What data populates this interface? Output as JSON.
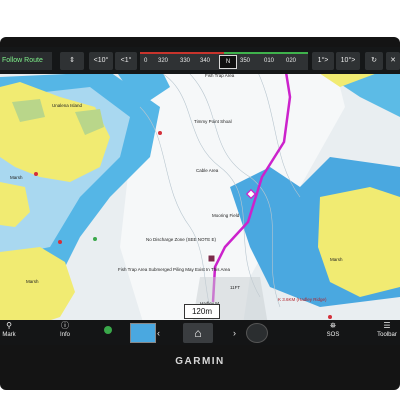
{
  "app": {
    "brand": "GARMIN"
  },
  "topbar": {
    "route_label": "Follow Route",
    "route_icon": "route-icon",
    "layer_icon": "layers-icon",
    "steer_buttons": [
      "<10°",
      "<1°",
      "1°>",
      "10°>"
    ],
    "compass": {
      "labels": [
        "0",
        "320",
        "330",
        "340",
        "350",
        "N",
        "010",
        "020"
      ],
      "heading": "N"
    },
    "refresh_icon": "refresh-icon",
    "close_icon": "close-icon"
  },
  "map": {
    "labels": [
      "Fish Trap Area",
      "Unalena Island",
      "Timmy Point Shoal",
      "Cable Area",
      "Marsh",
      "Mooring Field",
      "No Discharge Zone (SEE NOTE E)",
      "Fish Trap Area Submerged Piling May Exist In This Area",
      "Marsh",
      "11FT",
      "Hadley M",
      "K 3.6KM (Hadley Ridge)",
      "Marsh"
    ],
    "red_labels": [
      "No Discharge",
      "Cable Area"
    ],
    "scale": "120m",
    "colors": {
      "land": "#f1eb72",
      "shallow": "#4fb8e8",
      "deep": "#ffffff",
      "route": "#cc22cc"
    }
  },
  "bottombar": {
    "mark": "Mark",
    "info": "Info",
    "sos": "SOS",
    "toolbar": "Toolbar"
  }
}
